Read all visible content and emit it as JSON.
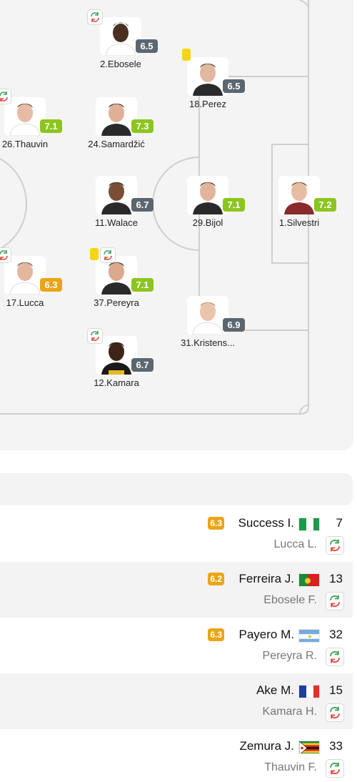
{
  "colors": {
    "rating_green": "#8cc51f",
    "rating_gray": "#5b6770",
    "rating_orange": "#eaa517",
    "yellow_card": "#f6d417",
    "sub_green": "#3aa35a",
    "sub_red": "#e0453a"
  },
  "players": [
    {
      "name": "2.Ebosele",
      "rating": "6.5",
      "rating_class": "gray",
      "sub_icon": "substitution-icon"
    },
    {
      "name": "18.Perez",
      "rating": "6.5",
      "rating_class": "gray",
      "card_icon": "yellow-card-icon"
    },
    {
      "name": "26.Thauvin",
      "rating": "7.1",
      "rating_class": "green",
      "sub_icon": "substitution-icon"
    },
    {
      "name": "24.Samardžić",
      "rating": "7.3",
      "rating_class": "green"
    },
    {
      "name": "11.Walace",
      "rating": "6.7",
      "rating_class": "gray"
    },
    {
      "name": "29.Bijol",
      "rating": "7.1",
      "rating_class": "green"
    },
    {
      "name": "1.Silvestri",
      "rating": "7.2",
      "rating_class": "green"
    },
    {
      "name": "17.Lucca",
      "rating": "6.3",
      "rating_class": "orange",
      "sub_icon": "substitution-icon"
    },
    {
      "name": "37.Pereyra",
      "rating": "7.1",
      "rating_class": "green",
      "card_icon": "yellow-card-icon",
      "sub_icon": "substitution-icon"
    },
    {
      "name": "31.Kristens...",
      "rating": "6.9",
      "rating_class": "gray"
    },
    {
      "name": "12.Kamara",
      "rating": "6.7",
      "rating_class": "gray",
      "sub_icon": "substitution-icon"
    }
  ],
  "substitutes": [
    {
      "rating": "6.3",
      "name": "Success I.",
      "flag": "nigeria-flag-icon",
      "number": "7",
      "replaced": "Lucca L."
    },
    {
      "rating": "6.2",
      "name": "Ferreira J.",
      "flag": "portugal-flag-icon",
      "number": "13",
      "replaced": "Ebosele F."
    },
    {
      "rating": "6.3",
      "name": "Payero M.",
      "flag": "argentina-flag-icon",
      "number": "32",
      "replaced": "Pereyra R."
    },
    {
      "rating": "",
      "name": "Ake M.",
      "flag": "france-flag-icon",
      "number": "15",
      "replaced": "Kamara H."
    },
    {
      "rating": "",
      "name": "Zemura J.",
      "flag": "zimbabwe-flag-icon",
      "number": "33",
      "replaced": "Thauvin F."
    }
  ]
}
